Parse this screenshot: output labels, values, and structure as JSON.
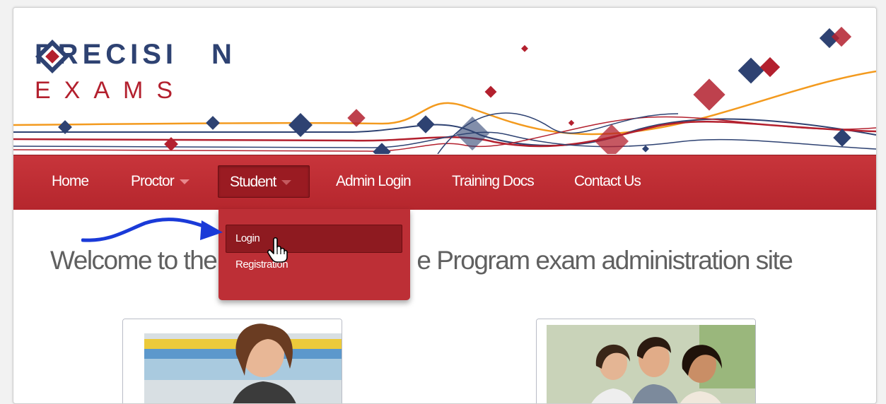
{
  "brand": {
    "name_top": "PRECISI",
    "name_top_end": "N",
    "name_bottom": "EXAMS"
  },
  "nav": {
    "items": [
      {
        "label": "Home"
      },
      {
        "label": "Proctor"
      },
      {
        "label": "Student"
      },
      {
        "label": "Admin Login"
      },
      {
        "label": "Training Docs"
      },
      {
        "label": "Contact Us"
      }
    ]
  },
  "student_menu": {
    "items": [
      {
        "label": "Login"
      },
      {
        "label": "Registration"
      }
    ]
  },
  "main": {
    "welcome_before": "Welcome to the",
    "welcome_after": "e Program exam administration site"
  },
  "colors": {
    "navy": "#2e4272",
    "red": "#b3202e",
    "orange": "#f39a1e",
    "nav_bg": "#c0303a",
    "annotation_arrow": "#1a3ad8"
  },
  "icons": {
    "logo_mark": "diamond-logo-icon",
    "caret": "caret-down-icon",
    "cursor": "hand-pointer-icon",
    "annotation": "curved-arrow-icon"
  }
}
